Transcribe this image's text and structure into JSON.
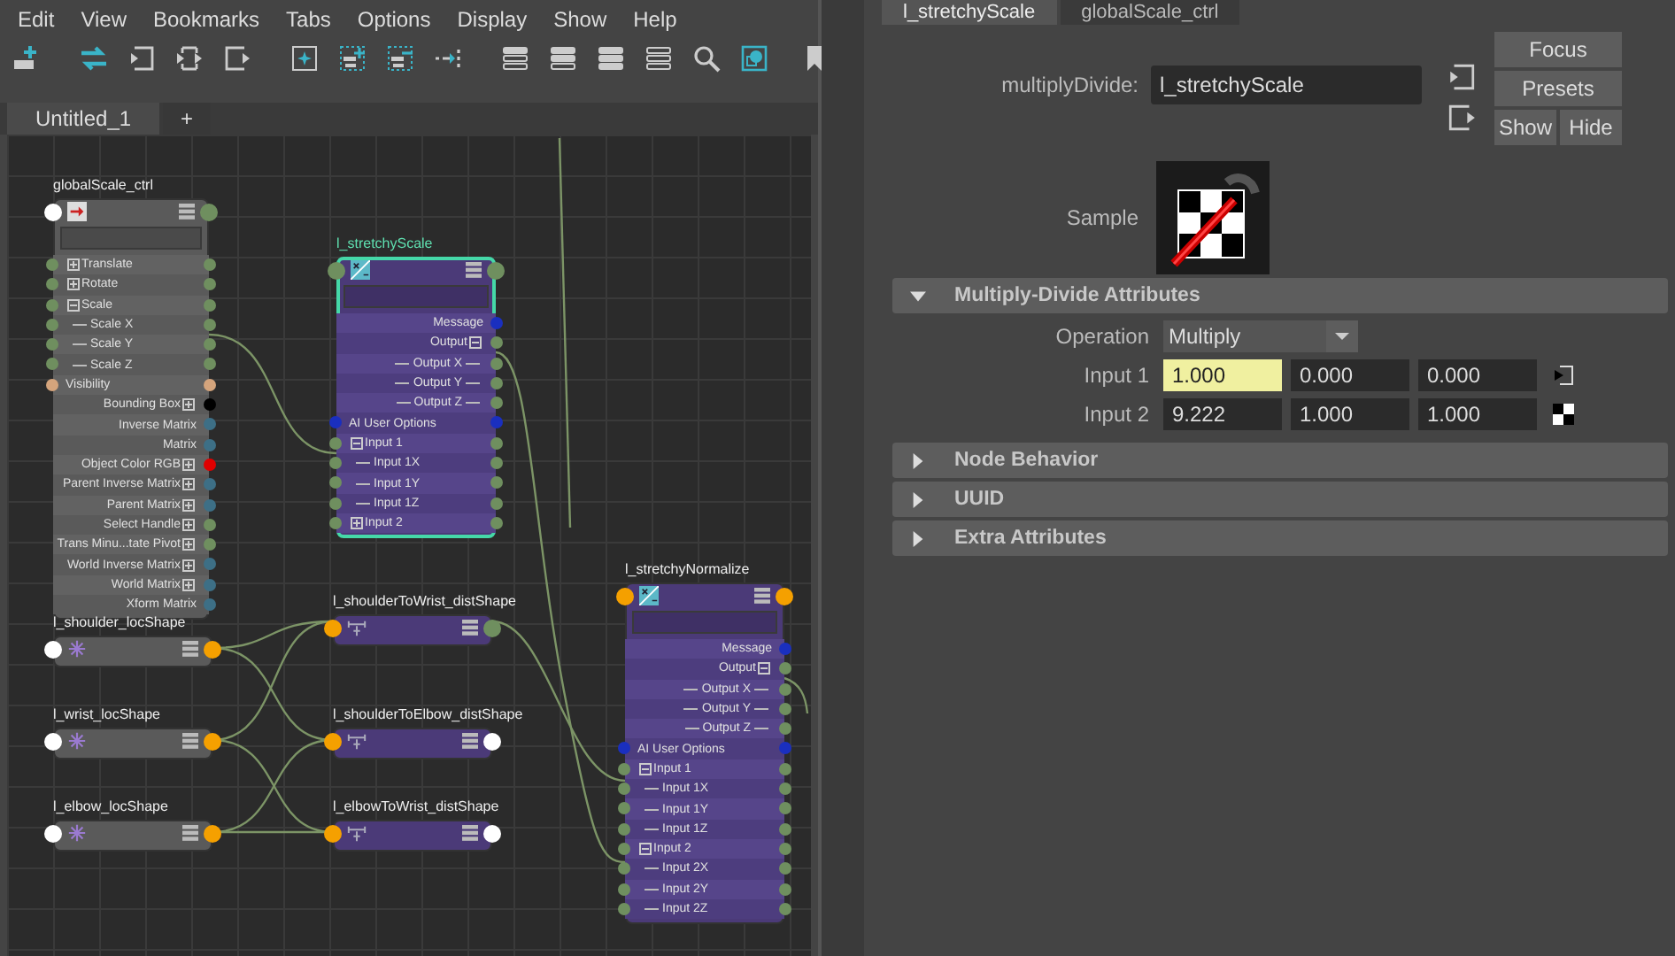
{
  "menu": [
    "Edit",
    "View",
    "Bookmarks",
    "Tabs",
    "Options",
    "Display",
    "Show",
    "Help"
  ],
  "editor_tabs": [
    {
      "label": "Untitled_1",
      "selected": true
    },
    {
      "label": "+",
      "selected": false
    }
  ],
  "nodes": [
    {
      "title": "globalScale_ctrl",
      "kind": "transform",
      "selected": false,
      "input_port": {
        "color": "#ffffff"
      },
      "output_port": {
        "color": "#6f8f5f"
      },
      "attributes": [
        {
          "label": "Translate",
          "kind": "input",
          "expanded": false,
          "color": "#6f8f5f"
        },
        {
          "label": "Rotate",
          "kind": "input",
          "expanded": false,
          "color": "#6f8f5f"
        },
        {
          "label": "Scale",
          "kind": "input",
          "expanded": true,
          "color": "#6f8f5f",
          "children": [
            {
              "label": "Scale X",
              "kind": "input",
              "color": "#6f8f5f"
            },
            {
              "label": "Scale Y",
              "kind": "input",
              "color": "#6f8f5f"
            },
            {
              "label": "Scale Z",
              "kind": "input",
              "color": "#6f8f5f"
            }
          ]
        },
        {
          "label": "Visibility",
          "kind": "input",
          "color": "#d4a47c"
        },
        {
          "label": "Bounding Box",
          "kind": "output",
          "expanded": false,
          "color": "#000000"
        },
        {
          "label": "Inverse Matrix",
          "kind": "output",
          "color": "#3d6f86"
        },
        {
          "label": "Matrix",
          "kind": "output",
          "color": "#3d6f86"
        },
        {
          "label": "Object Color RGB",
          "kind": "output",
          "expanded": false,
          "color": "#e00000"
        },
        {
          "label": "Parent Inverse Matrix",
          "kind": "output",
          "expanded": false,
          "color": "#3d6f86"
        },
        {
          "label": "Parent Matrix",
          "kind": "output",
          "expanded": false,
          "color": "#3d6f86"
        },
        {
          "label": "Select Handle",
          "kind": "output",
          "expanded": false,
          "color": "#6f8f5f"
        },
        {
          "label": "Trans Minu...tate Pivot",
          "kind": "output",
          "expanded": false,
          "color": "#6f8f5f"
        },
        {
          "label": "World Inverse Matrix",
          "kind": "output",
          "expanded": false,
          "color": "#3d6f86"
        },
        {
          "label": "World Matrix",
          "kind": "output",
          "expanded": false,
          "color": "#3d6f86"
        },
        {
          "label": "Xform Matrix",
          "kind": "output",
          "color": "#3d6f86"
        }
      ]
    },
    {
      "title": "l_stretchyScale",
      "kind": "utility",
      "selected": true,
      "input_port": {
        "color": "#6f8f5f"
      },
      "output_port": {
        "color": "#6f8f5f"
      },
      "attributes": [
        {
          "label": "Message",
          "kind": "output",
          "color": "#1a2fbf"
        },
        {
          "label": "Output",
          "kind": "output",
          "expanded": true,
          "color": "#6f8f5f",
          "children": [
            {
              "label": "Output X",
              "kind": "output",
              "color": "#6f8f5f"
            },
            {
              "label": "Output Y",
              "kind": "output",
              "color": "#6f8f5f"
            },
            {
              "label": "Output Z",
              "kind": "output",
              "color": "#6f8f5f"
            }
          ]
        },
        {
          "label": "AI User Options",
          "kind": "input",
          "color": "#1a2fbf"
        },
        {
          "label": "Input 1",
          "kind": "input",
          "expanded": true,
          "color": "#6f8f5f",
          "children": [
            {
              "label": "Input 1X",
              "kind": "input",
              "color": "#6f8f5f"
            },
            {
              "label": "Input 1Y",
              "kind": "input",
              "color": "#6f8f5f"
            },
            {
              "label": "Input 1Z",
              "kind": "input",
              "color": "#6f8f5f"
            }
          ]
        },
        {
          "label": "Input 2",
          "kind": "input",
          "expanded": false,
          "color": "#6f8f5f"
        }
      ]
    },
    {
      "title": "l_stretchyNormalize",
      "kind": "utility",
      "selected": false,
      "input_port": {
        "color": "#f5a000"
      },
      "output_port": {
        "color": "#f5a000"
      },
      "attributes": [
        {
          "label": "Message",
          "kind": "output",
          "color": "#1a2fbf"
        },
        {
          "label": "Output",
          "kind": "output",
          "expanded": true,
          "color": "#6f8f5f",
          "children": [
            {
              "label": "Output X",
              "kind": "output",
              "color": "#6f8f5f"
            },
            {
              "label": "Output Y",
              "kind": "output",
              "color": "#6f8f5f"
            },
            {
              "label": "Output Z",
              "kind": "output",
              "color": "#6f8f5f"
            }
          ]
        },
        {
          "label": "AI User Options",
          "kind": "input",
          "color": "#1a2fbf"
        },
        {
          "label": "Input 1",
          "kind": "input",
          "expanded": true,
          "color": "#6f8f5f",
          "children": [
            {
              "label": "Input 1X",
              "kind": "input",
              "color": "#6f8f5f"
            },
            {
              "label": "Input 1Y",
              "kind": "input",
              "color": "#6f8f5f"
            },
            {
              "label": "Input 1Z",
              "kind": "input",
              "color": "#6f8f5f"
            }
          ]
        },
        {
          "label": "Input 2",
          "kind": "input",
          "expanded": true,
          "color": "#6f8f5f",
          "children": [
            {
              "label": "Input 2X",
              "kind": "input",
              "color": "#6f8f5f"
            },
            {
              "label": "Input 2Y",
              "kind": "input",
              "color": "#6f8f5f"
            },
            {
              "label": "Input 2Z",
              "kind": "input",
              "color": "#6f8f5f"
            }
          ]
        }
      ]
    },
    {
      "title": "l_shoulder_locShape",
      "kind": "locator",
      "selected": false,
      "input_port": {
        "color": "#ffffff"
      },
      "output_port": {
        "color": "#f5a000"
      }
    },
    {
      "title": "l_shoulderToWrist_distShape",
      "kind": "distance",
      "selected": false,
      "input_port": {
        "color": "#f5a000"
      },
      "output_port": {
        "color": "#6f8f5f"
      }
    },
    {
      "title": "l_wrist_locShape",
      "kind": "locator",
      "selected": false,
      "input_port": {
        "color": "#ffffff"
      },
      "output_port": {
        "color": "#f5a000"
      }
    },
    {
      "title": "l_shoulderToElbow_distShape",
      "kind": "distance",
      "selected": false,
      "input_port": {
        "color": "#f5a000"
      },
      "output_port": {
        "color": "#ffffff"
      }
    },
    {
      "title": "l_elbow_locShape",
      "kind": "locator",
      "selected": false,
      "input_port": {
        "color": "#ffffff"
      },
      "output_port": {
        "color": "#f5a000"
      }
    },
    {
      "title": "l_elbowToWrist_distShape",
      "kind": "distance",
      "selected": false,
      "input_port": {
        "color": "#f5a000"
      },
      "output_port": {
        "color": "#ffffff"
      }
    }
  ],
  "attribute_editor": {
    "tabs": [
      {
        "label": "l_stretchyScale",
        "selected": true
      },
      {
        "label": "globalScale_ctrl",
        "selected": false
      }
    ],
    "node_type": "multiplyDivide:",
    "node_name": "l_stretchyScale",
    "buttons": [
      "Focus",
      "Presets",
      "Show",
      "Hide"
    ],
    "sample_label": "Sample",
    "sections": [
      {
        "title": "Multiply-Divide Attributes",
        "expanded": true,
        "fields": [
          {
            "kind": "dropdown",
            "label": "Operation",
            "value": "Multiply"
          },
          {
            "kind": "vector",
            "label": "Input 1",
            "button": {
              "kind": "connection"
            },
            "values": [
              {
                "text": "1.000",
                "highlighted": true
              },
              {
                "text": "0.000",
                "highlighted": false
              },
              {
                "text": "0.000",
                "highlighted": false
              }
            ]
          },
          {
            "kind": "vector",
            "label": "Input 2",
            "button": {
              "kind": "texture"
            },
            "values": [
              {
                "text": "9.222",
                "highlighted": false
              },
              {
                "text": "1.000",
                "highlighted": false
              },
              {
                "text": "1.000",
                "highlighted": false
              }
            ]
          }
        ]
      },
      {
        "title": "Node Behavior",
        "expanded": false
      },
      {
        "title": "UUID",
        "expanded": false
      },
      {
        "title": "Extra Attributes",
        "expanded": false
      }
    ]
  }
}
